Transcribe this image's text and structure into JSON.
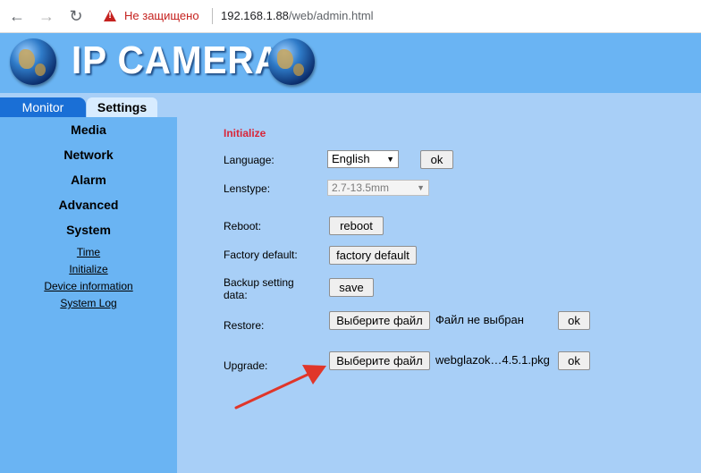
{
  "browser": {
    "back_icon": "←",
    "forward_icon": "→",
    "reload_icon": "↻",
    "not_secure": "Не защищено",
    "url_host": "192.168.1.88",
    "url_path": "/web/admin.html"
  },
  "header": {
    "logo_text": "IP CAMERA"
  },
  "tabs": {
    "monitor": "Monitor",
    "settings": "Settings"
  },
  "sidebar": {
    "media": "Media",
    "network": "Network",
    "alarm": "Alarm",
    "advanced": "Advanced",
    "system": "System",
    "links": {
      "time": "Time",
      "initialize": "Initialize",
      "device_information": "Device information",
      "system_log": "System Log"
    }
  },
  "main": {
    "section_title": "Initialize",
    "language": {
      "label": "Language:",
      "value": "English",
      "ok": "ok"
    },
    "lenstype": {
      "label": "Lenstype:",
      "value": "2.7-13.5mm"
    },
    "reboot": {
      "label": "Reboot:",
      "button": "reboot"
    },
    "factory_default": {
      "label": "Factory default:",
      "button": "factory default"
    },
    "backup": {
      "label_line1": "Backup setting",
      "label_line2": "data:",
      "button": "save"
    },
    "restore": {
      "label": "Restore:",
      "choose_file": "Выберите файл",
      "file_status": "Файл не выбран",
      "ok": "ok"
    },
    "upgrade": {
      "label": "Upgrade:",
      "choose_file": "Выберите файл",
      "file_status": "webglazok…4.5.1.pkg",
      "ok": "ok"
    }
  },
  "colors": {
    "header_bg": "#6ab4f3",
    "main_bg": "#a8cff7",
    "tab_active": "#1a6fd6",
    "section_title": "#d9263a",
    "annotation_arrow": "#e0362a"
  }
}
